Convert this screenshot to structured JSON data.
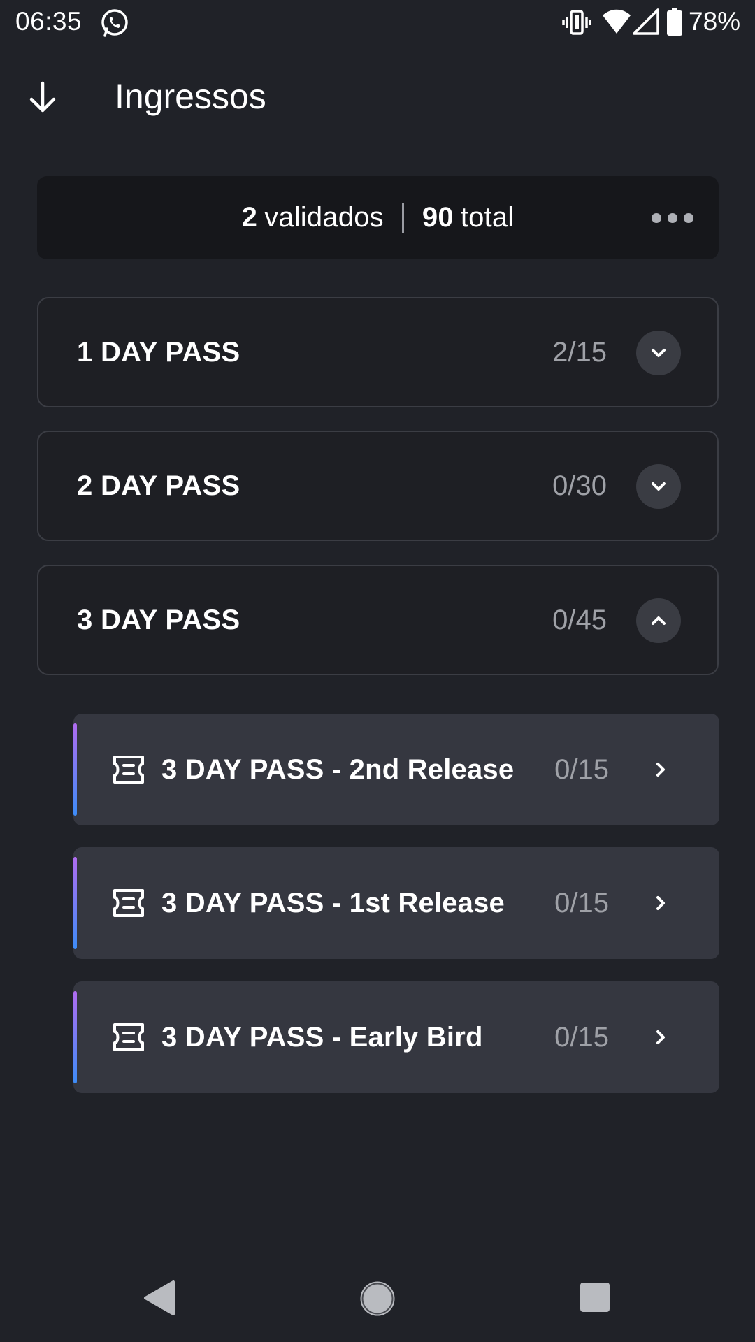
{
  "status_bar": {
    "time": "06:35",
    "battery": "78%",
    "icons": [
      "whatsapp-icon",
      "vibrate-icon",
      "wifi-icon",
      "signal-icon",
      "battery-icon"
    ]
  },
  "header": {
    "title": "Ingressos",
    "back_icon": "arrow-down-icon"
  },
  "summary": {
    "validated_count": "2",
    "validated_label": "validados",
    "total_count": "90",
    "total_label": "total",
    "more_icon": "more-horizontal-icon"
  },
  "pass_groups": [
    {
      "name": "1 DAY PASS",
      "count": "2/15",
      "expanded": false
    },
    {
      "name": "2 DAY PASS",
      "count": "0/30",
      "expanded": false
    },
    {
      "name": "3 DAY PASS",
      "count": "0/45",
      "expanded": true
    }
  ],
  "releases": [
    {
      "name": "3 DAY PASS - 2nd Release",
      "count": "0/15",
      "icon": "ticket-icon"
    },
    {
      "name": "3 DAY PASS - 1st Release",
      "count": "0/15",
      "icon": "ticket-icon"
    },
    {
      "name": "3 DAY PASS - Early Bird",
      "count": "0/15",
      "icon": "ticket-icon"
    }
  ],
  "colors": {
    "background": "#202228",
    "card": "#16171b",
    "release_card": "#353740",
    "accent_top": "#b06cf0",
    "accent_bottom": "#3d8cf7",
    "muted_text": "#9fa1a7"
  }
}
